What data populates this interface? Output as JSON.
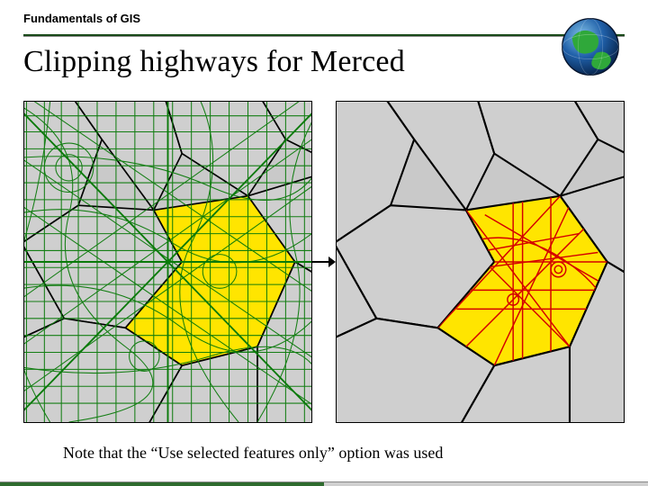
{
  "header": {
    "label": "Fundamentals of GIS"
  },
  "title": "Clipping highways for Merced",
  "footnote": "Note that the “Use selected features only” option was used",
  "icons": {
    "globe": "globe-icon",
    "arrow": "arrow-right-icon"
  },
  "maps": {
    "left": {
      "description": "California regional road network in green with Merced county highlighted yellow",
      "highlight_color": "#ffe500",
      "network_color": "#0a7a0a",
      "county_outline_color": "#000000",
      "background_color": "#c9c9c9"
    },
    "right": {
      "description": "County outlines only with clipped highways in red inside Merced",
      "highlight_color": "#ffe500",
      "clipped_color": "#d40000",
      "county_outline_color": "#000000",
      "background_color": "#c9c9c9"
    }
  }
}
